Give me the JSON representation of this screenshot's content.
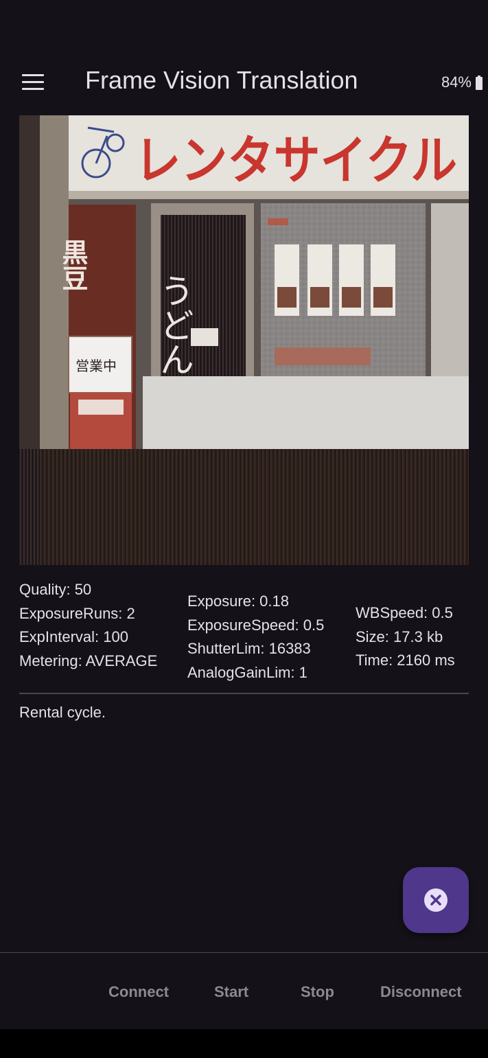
{
  "app": {
    "title": "Frame Vision Translation",
    "battery": "84%"
  },
  "image": {
    "sign_text": "レンタサイクル",
    "left_banner_text": "黒豆",
    "noren_text": "うどん そば",
    "open_sign_text": "営業中",
    "icons": [
      "bicycle-icon"
    ]
  },
  "stats": {
    "col1": [
      "Quality: 50",
      "ExposureRuns: 2",
      "ExpInterval: 100",
      "Metering: AVERAGE"
    ],
    "col2": [
      "Exposure: 0.18",
      "ExposureSpeed: 0.5",
      "ShutterLim: 16383",
      "AnalogGainLim: 1"
    ],
    "col3": [
      "WBSpeed: 0.5",
      "Size: 17.3 kb",
      "Time: 2160 ms"
    ]
  },
  "result": "Rental cycle.",
  "actions": {
    "connect": "Connect",
    "start": "Start",
    "stop": "Stop",
    "disconnect": "Disconnect"
  },
  "icons": {
    "menu": "menu-icon",
    "fab": "close-circle-icon",
    "battery": "battery-icon"
  },
  "colors": {
    "background": "#141218",
    "fab": "#4f378b",
    "disabled_text": "#8d8891"
  }
}
